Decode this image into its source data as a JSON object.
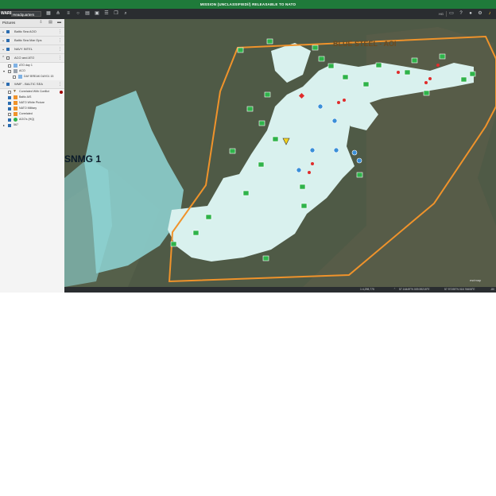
{
  "banner": {
    "text": "MISSION (UNCLASSIFIED//) RELEASABLE TO NATO",
    "color": "#1f7a3a"
  },
  "toolbar": {
    "brand": "WARE",
    "headquarters": "Headquarters",
    "user_initials": "HG",
    "icons": [
      "grid-icon",
      "hierarchy-icon",
      "list-icon",
      "circle-icon",
      "table-icon",
      "document-icon",
      "layers-icon",
      "copy-icon",
      "search-icon"
    ],
    "right_icons": [
      "menu-icon",
      "help-icon",
      "user-icon",
      "settings-icon",
      "bell-icon"
    ]
  },
  "sidebar": {
    "title": "Pictures",
    "layers": [
      {
        "label": "Baltic Sea AOO",
        "expanded": true,
        "checked": true
      },
      {
        "label": "Baltic Sea Mar Ops",
        "expanded": true,
        "checked": true
      },
      {
        "label": "NAVY INTEL",
        "expanded": true,
        "checked": true
      },
      {
        "label": "ACO and ATO",
        "expanded": false,
        "checked": false
      },
      {
        "label": "WMF - BALTIC SEA",
        "expanded": false,
        "checked": true
      }
    ],
    "aco_children": [
      {
        "label": "ATO day 1",
        "checked": false
      },
      {
        "label": "ACO",
        "checked": false,
        "folder": true
      },
      {
        "label": "DAY BREAK DAY01 15",
        "checked": false
      }
    ],
    "wmf_children": [
      {
        "label": "Correlated With Conflict",
        "checked": false,
        "status_dot": "#a00000"
      },
      {
        "label": "Baltic AIS",
        "checked": true
      },
      {
        "label": "NATO White Picture",
        "checked": true
      },
      {
        "label": "NATO Military",
        "checked": true
      },
      {
        "label": "Correlated",
        "checked": false
      },
      {
        "label": "AOO's (HQ)",
        "checked": true
      },
      {
        "label": "567",
        "checked": true
      }
    ]
  },
  "map": {
    "label_aoi": "BLUE STEEL - AOI",
    "label_snmg": "SNMG 1",
    "watermark": "esrimap",
    "aoi_color": "#f0932b",
    "water_color": "#d9f1ee",
    "shallow_color": "#8fd6d6",
    "land_color": "#4f5a46",
    "friendly_color": "#2fb34a",
    "hostile_color": "#e02b2b",
    "neutral_color": "#3a8fd8"
  },
  "status": {
    "scale": "1:4,298,775",
    "coord1": "57.16449°N 009.59215°E",
    "coord2": "57.97195°N 018.76608°E",
    "extra": "-80"
  }
}
